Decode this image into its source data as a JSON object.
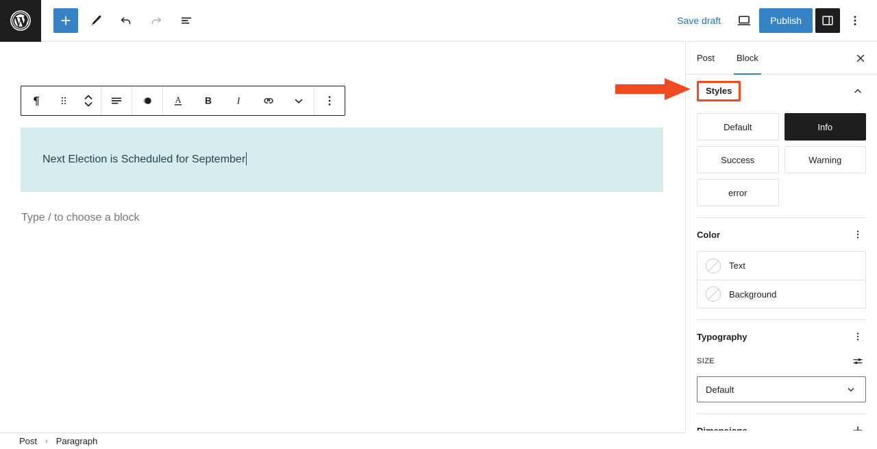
{
  "header": {
    "logo_icon": "wordpress-logo-icon",
    "tools": [
      {
        "name": "add-block-button",
        "icon": "plus-icon",
        "primary": true
      },
      {
        "name": "tools-edit-button",
        "icon": "pencil-icon",
        "primary": false
      },
      {
        "name": "undo-button",
        "icon": "undo-arrow-icon",
        "primary": false
      },
      {
        "name": "redo-button",
        "icon": "redo-arrow-icon",
        "primary": false,
        "disabled": true
      },
      {
        "name": "list-view-button",
        "icon": "list-view-icon",
        "primary": false
      }
    ],
    "save_draft_label": "Save draft",
    "preview_icon": "desktop-preview-icon",
    "publish_label": "Publish",
    "sidebar_toggle_icon": "sidebar-panel-icon",
    "more_options_icon": "vertical-ellipsis-icon",
    "accent_blue": "#3582c4",
    "link_blue": "#2271b1"
  },
  "block_toolbar": {
    "items": [
      {
        "name": "block-type-paragraph-button",
        "icon": "pilcrow-icon"
      },
      {
        "name": "drag-handle-button",
        "icon": "drag-dots-icon"
      },
      {
        "name": "move-updown-button",
        "icon": "chevron-up-down-icon"
      },
      {
        "name": "align-text-button",
        "icon": "align-text-icon"
      },
      {
        "name": "highlight-contrast-button",
        "icon": "contrast-circle-icon"
      },
      {
        "name": "text-color-button",
        "icon": "letter-a-underline-icon"
      },
      {
        "name": "bold-button",
        "icon": "bold-b-icon"
      },
      {
        "name": "italic-button",
        "icon": "italic-i-icon"
      },
      {
        "name": "link-button",
        "icon": "link-chain-icon"
      },
      {
        "name": "more-formatting-button",
        "icon": "chevron-down-icon"
      },
      {
        "name": "block-options-button",
        "icon": "vertical-ellipsis-icon"
      }
    ]
  },
  "editor": {
    "paragraph_text": "Next Election is Scheduled for September",
    "paragraph_background": "#d6edee",
    "paragraph_text_color": "#23414f",
    "empty_block_placeholder": "Type / to choose a block"
  },
  "breadcrumb": {
    "items": [
      "Post",
      "Paragraph"
    ],
    "separator": "›"
  },
  "sidebar": {
    "tabs": [
      {
        "label": "Post",
        "active": false
      },
      {
        "label": "Block",
        "active": true
      }
    ],
    "close_icon": "close-x-icon",
    "styles_panel": {
      "title": "Styles",
      "collapse_icon": "chevron-up-icon",
      "variations": [
        {
          "label": "Default",
          "selected": false
        },
        {
          "label": "Info",
          "selected": true
        },
        {
          "label": "Success",
          "selected": false
        },
        {
          "label": "Warning",
          "selected": false
        },
        {
          "label": "error",
          "selected": false
        }
      ]
    },
    "color_panel": {
      "title": "Color",
      "options_icon": "vertical-ellipsis-icon",
      "rows": [
        {
          "label": "Text",
          "swatch_icon": "empty-color-swatch-icon"
        },
        {
          "label": "Background",
          "swatch_icon": "empty-color-swatch-icon"
        }
      ]
    },
    "typography_panel": {
      "title": "Typography",
      "options_icon": "vertical-ellipsis-icon",
      "size_label": "SIZE",
      "size_settings_icon": "sliders-icon",
      "size_value": "Default",
      "dropdown_icon": "chevron-down-icon"
    },
    "dimensions_panel": {
      "title": "Dimensions",
      "add_icon": "plus-icon"
    }
  },
  "annotation": {
    "arrow_color": "#f04a23",
    "highlight_color": "#f04a23",
    "points_at": "Styles"
  }
}
